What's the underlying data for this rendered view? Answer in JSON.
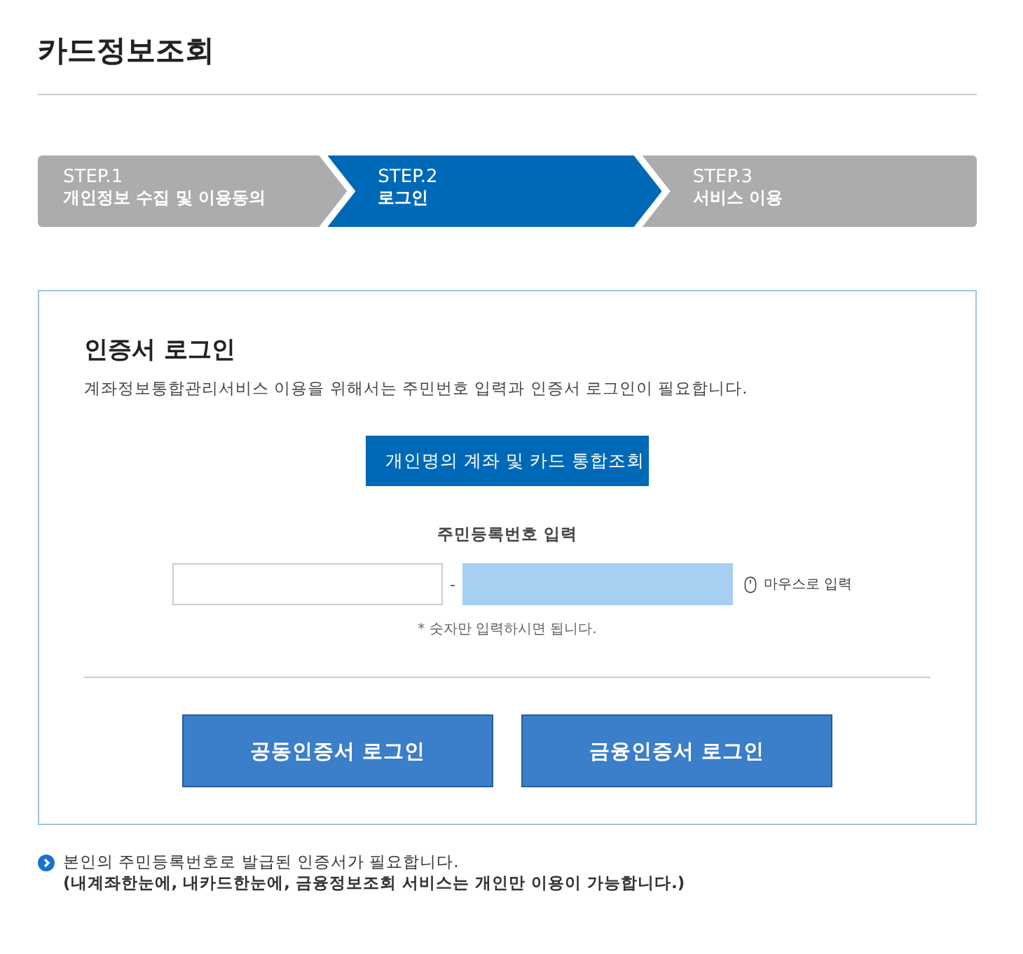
{
  "page_title": "카드정보조회",
  "steps": [
    {
      "number": "STEP.1",
      "label": "개인정보 수집 및 이용동의",
      "selected": false
    },
    {
      "number": "STEP.2",
      "label": "로그인",
      "selected": true
    },
    {
      "number": "STEP.3",
      "label": "서비스 이용",
      "selected": false
    }
  ],
  "login_card": {
    "title": "인증서 로그인",
    "description": "계좌정보통합관리서비스 이용을 위해서는 주민번호 입력과 인증서 로그인이 필요합니다.",
    "lookup_button": "개인명의 계좌 및 카드 통합조회",
    "id_label": "주민등록번호 입력",
    "separator": "-",
    "mouse_input": "마우스로 입력",
    "hint": "* 숫자만 입력하시면 됩니다.",
    "login_buttons": [
      "공동인증서 로그인",
      "금융인증서 로그인"
    ]
  },
  "notice": [
    "본인의 주민등록번호로 발급된 인증서가 필요합니다.",
    "(내계좌한눈에, 내카드한눈에, 금융정보조회 서비스는 개인만 이용이 가능합니다.)"
  ]
}
